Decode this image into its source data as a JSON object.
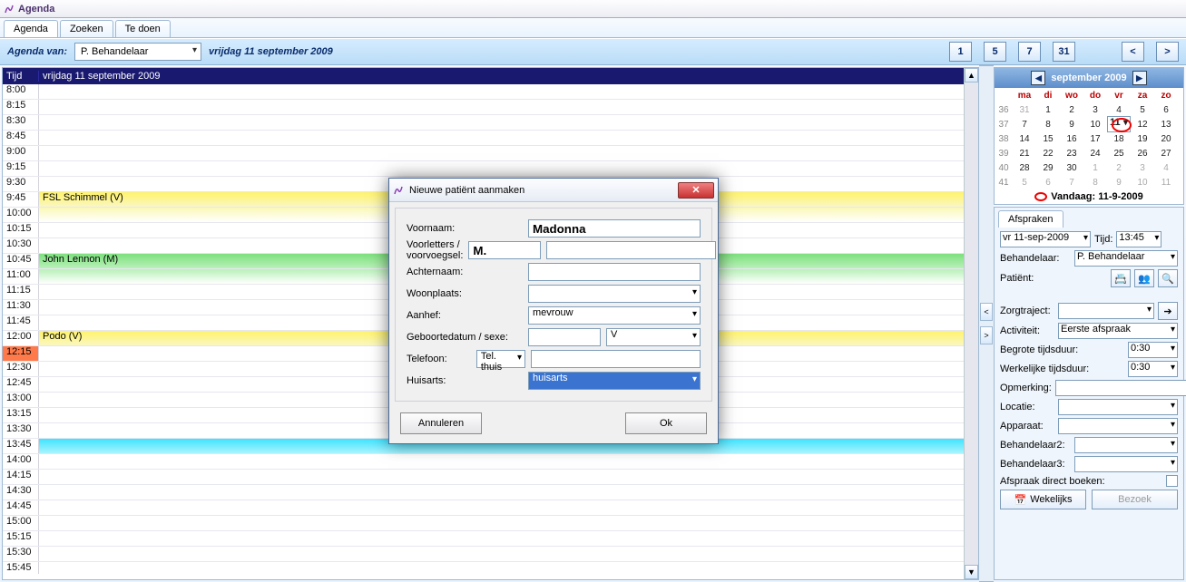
{
  "window": {
    "title": "Agenda"
  },
  "tabs": [
    "Agenda",
    "Zoeken",
    "Te doen"
  ],
  "toolbar": {
    "agenda_van": "Agenda van:",
    "behandelaar": "P. Behandelaar",
    "date": "vrijdag 11 september 2009",
    "view_buttons": [
      "1",
      "5",
      "7",
      "31"
    ],
    "nav_prev": "<",
    "nav_next": ">"
  },
  "grid": {
    "col_time": "Tijd",
    "col_day": "vrijdag 11 september 2009",
    "slots": [
      {
        "t": "8:00"
      },
      {
        "t": "8:15"
      },
      {
        "t": "8:30"
      },
      {
        "t": "8:45"
      },
      {
        "t": "9:00"
      },
      {
        "t": "9:15"
      },
      {
        "t": "9:30"
      },
      {
        "t": "9:45",
        "txt": "FSL Schimmel (V)",
        "cls": "yellow"
      },
      {
        "t": "10:00",
        "cls": "yellow-soft"
      },
      {
        "t": "10:15"
      },
      {
        "t": "10:30"
      },
      {
        "t": "10:45",
        "txt": "John Lennon (M)",
        "cls": "green"
      },
      {
        "t": "11:00",
        "cls": "green-soft"
      },
      {
        "t": "11:15"
      },
      {
        "t": "11:30"
      },
      {
        "t": "11:45"
      },
      {
        "t": "12:00",
        "txt": "Podo (V)",
        "cls": "yellow2"
      },
      {
        "t": "12:15",
        "cls": "orange"
      },
      {
        "t": "12:30"
      },
      {
        "t": "12:45"
      },
      {
        "t": "13:00"
      },
      {
        "t": "13:15"
      },
      {
        "t": "13:30"
      },
      {
        "t": "13:45",
        "cls": "cyan"
      },
      {
        "t": "14:00"
      },
      {
        "t": "14:15"
      },
      {
        "t": "14:30"
      },
      {
        "t": "14:45"
      },
      {
        "t": "15:00"
      },
      {
        "t": "15:15"
      },
      {
        "t": "15:30"
      },
      {
        "t": "15:45"
      }
    ]
  },
  "calendar": {
    "label": "september 2009",
    "dow": [
      "ma",
      "di",
      "wo",
      "do",
      "vr",
      "za",
      "zo"
    ],
    "weeks": [
      {
        "wk": "36",
        "d": [
          "31",
          "1",
          "2",
          "3",
          "4",
          "5",
          "6"
        ],
        "off0": true
      },
      {
        "wk": "37",
        "d": [
          "7",
          "8",
          "9",
          "10",
          "11",
          "12",
          "13"
        ],
        "sel": 4
      },
      {
        "wk": "38",
        "d": [
          "14",
          "15",
          "16",
          "17",
          "18",
          "19",
          "20"
        ]
      },
      {
        "wk": "39",
        "d": [
          "21",
          "22",
          "23",
          "24",
          "25",
          "26",
          "27"
        ]
      },
      {
        "wk": "40",
        "d": [
          "28",
          "29",
          "30",
          "1",
          "2",
          "3",
          "4"
        ],
        "offFrom": 3
      },
      {
        "wk": "41",
        "d": [
          "5",
          "6",
          "7",
          "8",
          "9",
          "10",
          "11"
        ],
        "offAll": true
      }
    ],
    "today_label": "Vandaag: 11-9-2009"
  },
  "afspraken": {
    "tab": "Afspraken",
    "date": "vr 11-sep-2009",
    "tijd_label": "Tijd:",
    "tijd": "13:45",
    "beh_label": "Behandelaar:",
    "beh": "P. Behandelaar",
    "pat_label": "Patiënt:",
    "zorg_label": "Zorgtraject:",
    "zorg": "",
    "act_label": "Activiteit:",
    "act": "Eerste afspraak",
    "begrote_label": "Begrote tijdsduur:",
    "begrote": "0:30",
    "werk_label": "Werkelijke tijdsduur:",
    "werk": "0:30",
    "opm_label": "Opmerking:",
    "loc_label": "Locatie:",
    "app_label": "Apparaat:",
    "beh2_label": "Behandelaar2:",
    "beh3_label": "Behandelaar3:",
    "boek_label": "Afspraak direct boeken:",
    "wekelijks": "Wekelijks",
    "bezoek": "Bezoek"
  },
  "dialog": {
    "title": "Nieuwe patiënt aanmaken",
    "voornaam_l": "Voornaam:",
    "voornaam": "Madonna",
    "voorl_l": "Voorletters / voorvoegsel:",
    "voorl": "M.",
    "achternaam_l": "Achternaam:",
    "woon_l": "Woonplaats:",
    "aanhef_l": "Aanhef:",
    "aanhef": "mevrouw",
    "geb_l": "Geboortedatum / sexe:",
    "sexe": "V",
    "tel_l": "Telefoon:",
    "tel_type": "Tel. thuis",
    "huis_l": "Huisarts:",
    "huis": "huisarts",
    "annuleren": "Annuleren",
    "ok": "Ok"
  }
}
